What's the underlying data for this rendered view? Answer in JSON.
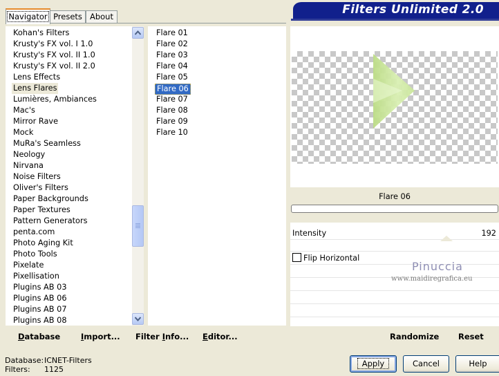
{
  "tabs": [
    "Navigator",
    "Presets",
    "About"
  ],
  "banner_title": "Filters Unlimited 2.0",
  "filter_categories": [
    "Kohan's Filters",
    "Krusty's FX vol. I 1.0",
    "Krusty's FX vol. II 1.0",
    "Krusty's FX vol. II 2.0",
    "Lens Effects",
    "Lens Flares",
    "Lumières, Ambiances",
    "Mac's",
    "Mirror Rave",
    "Mock",
    "MuRa's Seamless",
    "Neology",
    "Nirvana",
    "Noise Filters",
    "Oliver's Filters",
    "Paper Backgrounds",
    "Paper Textures",
    "Pattern Generators",
    "penta.com",
    "Photo Aging Kit",
    "Photo Tools",
    "Pixelate",
    "Pixellisation",
    "Plugins AB 03",
    "Plugins AB 06",
    "Plugins AB 07",
    "Plugins AB 08"
  ],
  "selected_category": "Lens Flares",
  "effects": [
    "Flare 01",
    "Flare 02",
    "Flare 03",
    "Flare 04",
    "Flare 05",
    "Flare 06",
    "Flare 07",
    "Flare 08",
    "Flare 09",
    "Flare 10"
  ],
  "selected_effect": "Flare 06",
  "preview_name": "Flare 06",
  "params": {
    "intensity_label": "Intensity",
    "intensity_value": "192",
    "flip_label": "Flip Horizontal",
    "flip_checked": false
  },
  "watermark": {
    "line1": "Pinuccia",
    "line2": "www.maidiregrafica.eu"
  },
  "toolbar": {
    "database": {
      "u": "D",
      "rest": "atabase"
    },
    "import": {
      "u": "I",
      "rest": "mport..."
    },
    "filter_info": {
      "pre": "Filter ",
      "u": "I",
      "rest": "nfo..."
    },
    "editor": {
      "u": "E",
      "rest": "ditor..."
    },
    "randomize": "Randomize",
    "reset": "Reset"
  },
  "status": {
    "database_label": "Database:",
    "database_value": "ICNET-Filters",
    "filters_label": "Filters:",
    "filters_value": "1125"
  },
  "buttons": {
    "apply": "Apply",
    "cancel": "Cancel",
    "help": "Help"
  },
  "colors": {
    "banner": "#11208c",
    "selection": "#316ac5",
    "flare": "#c9e59a"
  }
}
